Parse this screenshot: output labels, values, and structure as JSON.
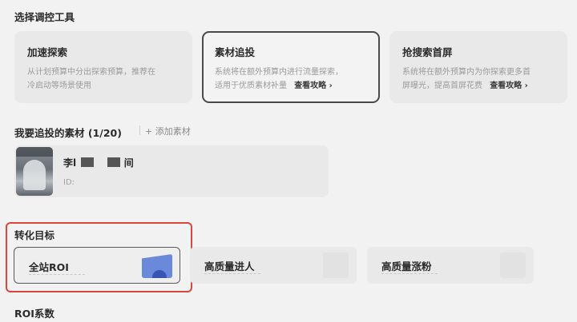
{
  "tools_section": {
    "title": "选择调控工具",
    "cards": [
      {
        "name": "加速探索",
        "desc_line1": "从计划预算中分出探索预算，推荐在",
        "desc_line2": "冷启动等场景使用",
        "link": ""
      },
      {
        "name": "素材追投",
        "desc_line1": "系统将在额外预算内进行流量探索，",
        "desc_line2": "适用于优质素材补量",
        "link": "查看攻略 ›"
      },
      {
        "name": "抢搜索首屏",
        "desc_line1": "系统将在额外预算内为你探索更多首",
        "desc_line2": "屏曝光，提高首屏花费",
        "link": "查看攻略 ›"
      }
    ]
  },
  "materials_section": {
    "title": "我要追投的素材 (1/20)",
    "add_label": "+ 添加素材",
    "item": {
      "name_prefix": "李l",
      "name_suffix": "间",
      "id_label": "ID:"
    }
  },
  "goal_section": {
    "title": "转化目标",
    "options": [
      {
        "label": "全站ROI",
        "selected": true
      },
      {
        "label": "高质量进人",
        "selected": false
      },
      {
        "label": "高质量涨粉",
        "selected": false
      }
    ]
  },
  "roi_section": {
    "title": "ROI系数"
  },
  "colors": {
    "highlight_border": "#d9463b",
    "roi_icon": "#4a6fd6"
  }
}
